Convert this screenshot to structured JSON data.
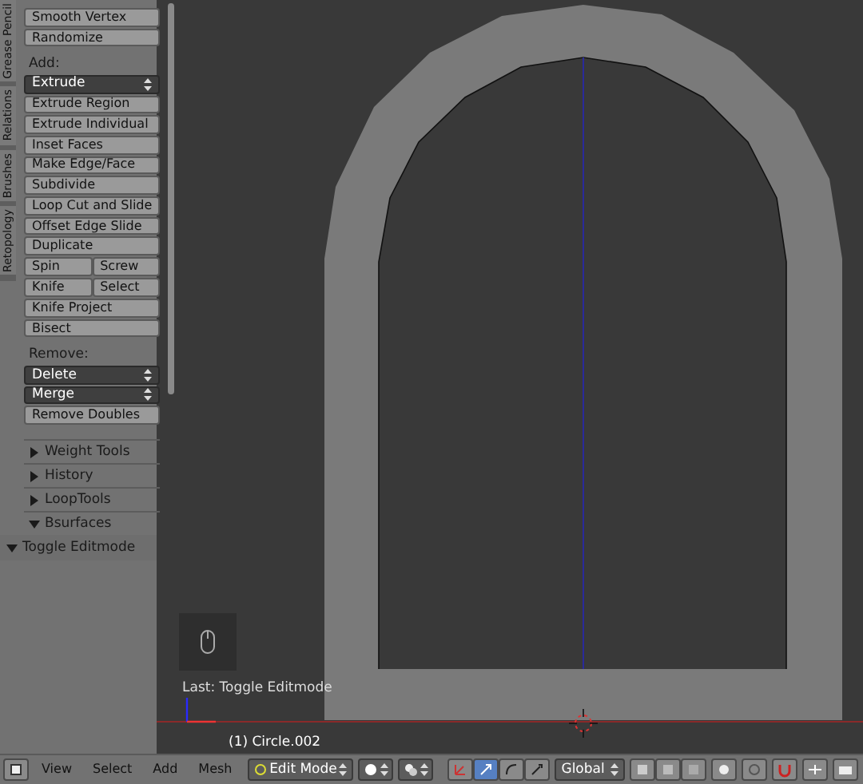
{
  "tool_shelf": {
    "tabs": [
      {
        "label": "Grease Pencil"
      },
      {
        "label": "Relations"
      },
      {
        "label": "Brushes"
      },
      {
        "label": "Retopology"
      }
    ],
    "items": [
      {
        "kind": "button",
        "label": "Smooth Vertex"
      },
      {
        "kind": "button",
        "label": "Randomize"
      },
      {
        "kind": "heading",
        "label": "Add:"
      },
      {
        "kind": "dropdown",
        "label": "Extrude"
      },
      {
        "kind": "button",
        "label": "Extrude Region"
      },
      {
        "kind": "button",
        "label": "Extrude Individual"
      },
      {
        "kind": "button",
        "label": "Inset Faces"
      },
      {
        "kind": "button",
        "label": "Make Edge/Face"
      },
      {
        "kind": "button",
        "label": "Subdivide"
      },
      {
        "kind": "button",
        "label": "Loop Cut and Slide"
      },
      {
        "kind": "button",
        "label": "Offset Edge Slide"
      },
      {
        "kind": "button",
        "label": "Duplicate"
      },
      {
        "kind": "pair",
        "labels": [
          "Spin",
          "Screw"
        ]
      },
      {
        "kind": "pair",
        "labels": [
          "Knife",
          "Select"
        ]
      },
      {
        "kind": "button",
        "label": "Knife Project"
      },
      {
        "kind": "button",
        "label": "Bisect"
      },
      {
        "kind": "heading",
        "label": "Remove:"
      },
      {
        "kind": "dropdown",
        "label": "Delete"
      },
      {
        "kind": "dropdown",
        "label": "Merge"
      },
      {
        "kind": "button",
        "label": "Remove Doubles"
      }
    ],
    "panels": [
      {
        "title": "Weight Tools",
        "expanded": false
      },
      {
        "title": "History",
        "expanded": false
      },
      {
        "title": "LoopTools",
        "expanded": false
      },
      {
        "title": "Bsurfaces",
        "expanded": true
      }
    ]
  },
  "operator_panel": {
    "title": "Toggle Editmode",
    "expanded": true
  },
  "viewport": {
    "last_operator": "Last: Toggle Editmode",
    "object_info": "(1) Circle.002"
  },
  "header": {
    "menus": [
      "View",
      "Select",
      "Add",
      "Mesh"
    ],
    "mode": "Edit Mode",
    "orientation": "Global"
  }
}
